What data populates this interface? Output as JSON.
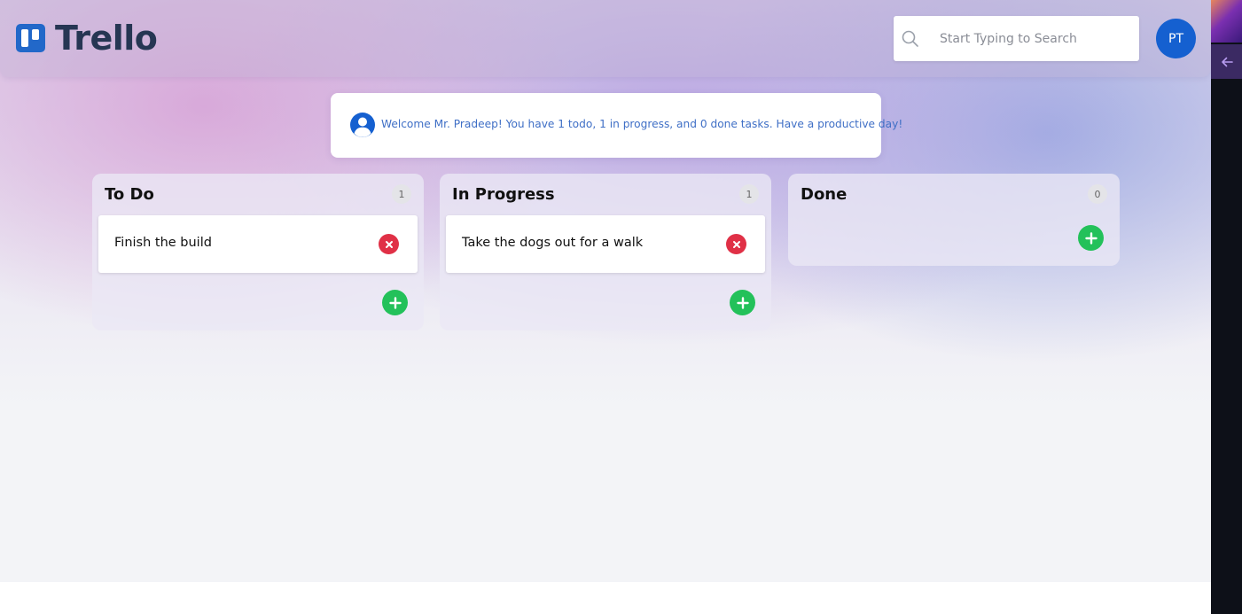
{
  "header": {
    "logo_text": "Trello",
    "search": {
      "placeholder": "Start Typing to Search"
    },
    "avatar_initials": "PT"
  },
  "welcome": {
    "message": "Welcome Mr. Pradeep! You have 1 todo, 1 in progress, and 0 done tasks. Have a productive day!"
  },
  "columns": [
    {
      "title": "To Do",
      "count": "1",
      "cards": [
        {
          "text": "Finish the build"
        }
      ]
    },
    {
      "title": "In Progress",
      "count": "1",
      "cards": [
        {
          "text": "Take the dogs out for a walk"
        }
      ]
    },
    {
      "title": "Done",
      "count": "0",
      "cards": []
    }
  ],
  "colors": {
    "brand": "#2268c9",
    "avatar": "#1560d0",
    "delete": "#e03046",
    "add": "#23c15a",
    "welcome_text": "#3f6fc6"
  },
  "icons": {
    "logo": "trello-logo-icon",
    "search": "search-icon",
    "user": "user-circle-icon",
    "delete": "close-icon",
    "add": "plus-icon",
    "sidebar": "arrow-left-icon"
  }
}
